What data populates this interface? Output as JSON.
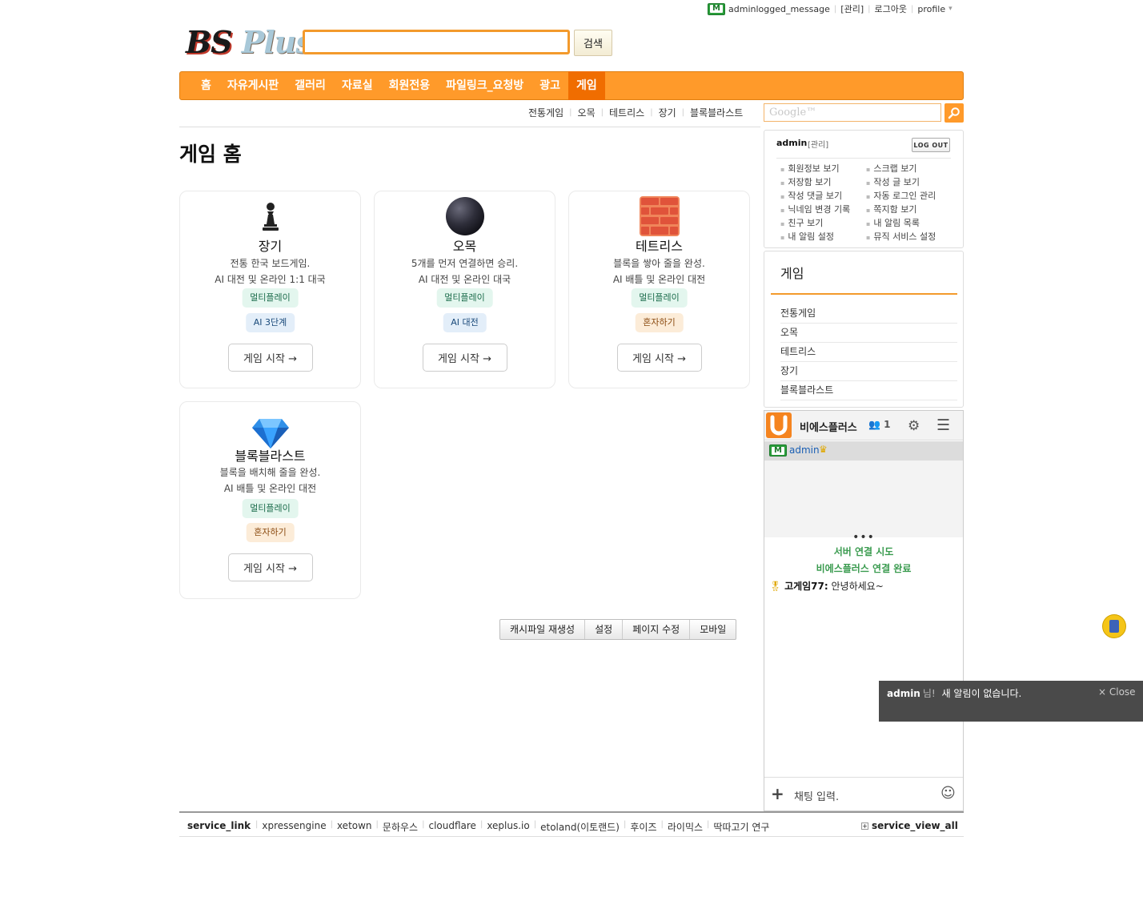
{
  "topbar": {
    "message": "adminlogged_message",
    "manage": "[관리]",
    "logout": "로그아웃",
    "profile": "profile"
  },
  "logo": {
    "part1": "BS",
    "part2": "Plus"
  },
  "search": {
    "button": "검색",
    "value": ""
  },
  "gnb": [
    "홈",
    "자유게시판",
    "갤러리",
    "자료실",
    "회원전용",
    "파일링크_요청방",
    "광고",
    "게임"
  ],
  "gnb_active": "게임",
  "subnav": [
    "전통게임",
    "오목",
    "테트리스",
    "장기",
    "블록블라스트"
  ],
  "google": {
    "placeholder": "Google™"
  },
  "page_title": "게임 홈",
  "cards": [
    {
      "title": "장기",
      "desc1": "전통 한국 보드게임.",
      "desc2": "AI 대전 및 온라인 1:1 대국",
      "tag1": "멀티플레이",
      "tag2": "AI 3단계",
      "button": "게임 시작 →",
      "icon": "chess-pawn-icon"
    },
    {
      "title": "오목",
      "desc1": "5개를 먼저 연결하면 승리.",
      "desc2": "AI 대전 및 온라인 대국",
      "tag1": "멀티플레이",
      "tag2": "AI 대전",
      "button": "게임 시작 →",
      "icon": "black-stone-icon"
    },
    {
      "title": "테트리스",
      "desc1": "블록을 쌓아 줄을 완성.",
      "desc2": "AI 배틀 및 온라인 대전",
      "tag1": "멀티플레이",
      "tag2": "혼자하기",
      "button": "게임 시작 →",
      "icon": "brick-icon"
    },
    {
      "title": "블록블라스트",
      "desc1": "블록을 배치해 줄을 완성.",
      "desc2": "AI 배틀 및 온라인 대전",
      "tag1": "멀티플레이",
      "tag2": "혼자하기",
      "button": "게임 시작 →",
      "icon": "diamond-icon"
    }
  ],
  "admin_buttons": [
    "캐시파일 재생성",
    "설정",
    "페이지 수정",
    "모바일"
  ],
  "login": {
    "user": "admin",
    "manage": "[관리]",
    "logout": "LOG OUT",
    "left_links": [
      "회원정보 보기",
      "저장함 보기",
      "작성 댓글 보기",
      "닉네임 변경 기록",
      "친구 보기",
      "내 알림 설정"
    ],
    "right_links": [
      "스크랩 보기",
      "작성 글 보기",
      "자동 로그인 관리",
      "쪽지함 보기",
      "내 알림 목록",
      "뮤직 서비스 설정"
    ]
  },
  "sidemenu": {
    "title": "게임",
    "items": [
      "전통게임",
      "오목",
      "테트리스",
      "장기",
      "블록블라스트"
    ]
  },
  "chat": {
    "name": "비에스플러스",
    "count": "1",
    "user": "admin",
    "dots": "•••",
    "sys1": "서버 연결 시도",
    "sys2": "비에스플러스 연결 완료",
    "msg_user": "고게임77:",
    "msg_text": "안녕하세요~",
    "input_placeholder": "채팅 입력."
  },
  "notice": {
    "user": "admin",
    "suffix": "님!",
    "text": "새 알림이 없습니다.",
    "close": "× Close"
  },
  "footer": {
    "label": "service_link",
    "links": [
      "xpressengine",
      "xetown",
      "문하우스",
      "cloudflare",
      "xeplus.io",
      "etoland(이토랜드)",
      "후이즈",
      "라이믹스",
      "딱따고기 연구"
    ],
    "view_all": "service_view_all"
  },
  "colors": {
    "accent": "#ff9a2a",
    "nav_active": "#f06d00",
    "chat_system": "#3a9b4f"
  }
}
